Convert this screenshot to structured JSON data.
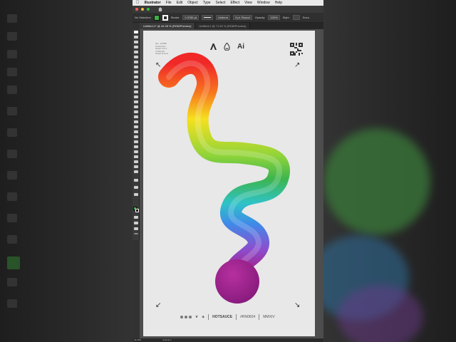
{
  "menubar": {
    "app_name": "Illustrator",
    "items": [
      "File",
      "Edit",
      "Object",
      "Type",
      "Select",
      "Effect",
      "View",
      "Window",
      "Help"
    ]
  },
  "control": {
    "selection_label": "No Selection",
    "stroke_label": "Stroke:",
    "stroke_value": "0.3786 pt",
    "profile_value": "Uniform",
    "brush_value": "3 pt. Round",
    "opacity_label": "Opacity:",
    "opacity_value": "100%",
    "style_label": "Style:",
    "doc_setup_label": "Docu"
  },
  "tabs": [
    {
      "label": "Untitled-1* @ 44.28 % (RGB/Preview)",
      "active": true
    },
    {
      "label": "Untitled-2 @ 71.62 % (RGB/Preview)",
      "active": false
    }
  ],
  "artboard": {
    "meta_lines": [
      "Ref. : ADOBE",
      "Ad Illustrator",
      "3D/AD 1.0.8.4",
      "3 D/Render",
      "Design Process"
    ],
    "ai_label": "Ai",
    "footer": {
      "brand": "HOTSAUCE",
      "code": "#RN0824",
      "tail": "MMXIV"
    }
  },
  "statusbar": {
    "zoom": "44.28%",
    "tool": "Selection"
  },
  "colors": {
    "fill": "#3cb043",
    "artboard": "#e8e8e8",
    "workspace": "#4d4d4d",
    "sphere": "#9a1f8f"
  },
  "icons": [
    "apple-icon",
    "home-icon",
    "adobe-icon",
    "drop-icon",
    "qr-code-icon",
    "arrow-icon",
    "leaf-icon"
  ]
}
